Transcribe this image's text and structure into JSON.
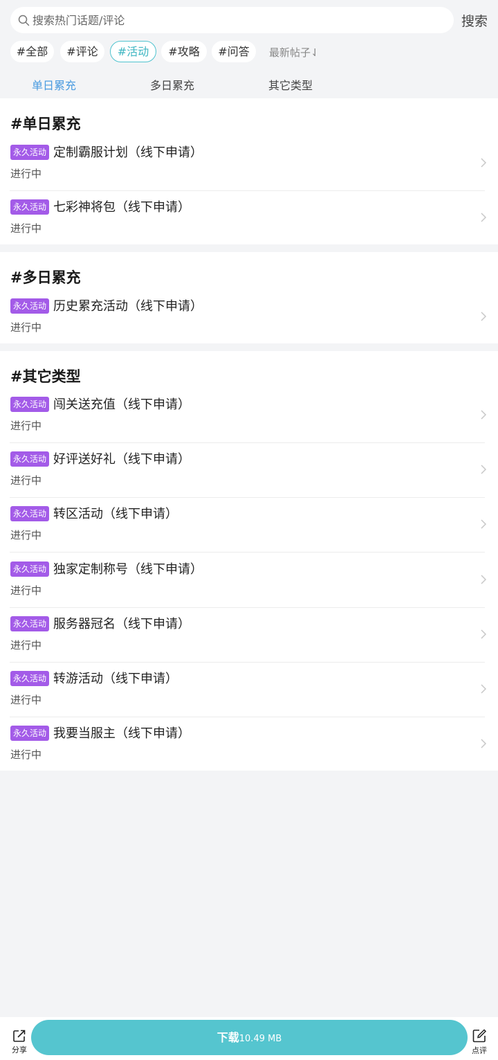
{
  "search": {
    "placeholder": "搜索热门话题/评论",
    "button": "搜索"
  },
  "chips": [
    {
      "label": "#全部"
    },
    {
      "label": "#评论"
    },
    {
      "label": "#活动"
    },
    {
      "label": "#攻略"
    },
    {
      "label": "#问答"
    }
  ],
  "sort_label": "最新帖子⇃",
  "tabs": [
    {
      "label": "单日累充"
    },
    {
      "label": "多日累充"
    },
    {
      "label": "其它类型"
    }
  ],
  "sections": [
    {
      "title": "#单日累充",
      "items": [
        {
          "badge": "永久活动",
          "title": "定制霸服计划（线下申请）",
          "status": "进行中"
        },
        {
          "badge": "永久活动",
          "title": "七彩神将包（线下申请）",
          "status": "进行中"
        }
      ]
    },
    {
      "title": "#多日累充",
      "items": [
        {
          "badge": "永久活动",
          "title": "历史累充活动（线下申请）",
          "status": "进行中"
        }
      ]
    },
    {
      "title": "#其它类型",
      "items": [
        {
          "badge": "永久活动",
          "title": "闯关送充值（线下申请）",
          "status": "进行中"
        },
        {
          "badge": "永久活动",
          "title": "好评送好礼（线下申请）",
          "status": "进行中"
        },
        {
          "badge": "永久活动",
          "title": "转区活动（线下申请）",
          "status": "进行中"
        },
        {
          "badge": "永久活动",
          "title": "独家定制称号（线下申请）",
          "status": "进行中"
        },
        {
          "badge": "永久活动",
          "title": "服务器冠名（线下申请）",
          "status": "进行中"
        },
        {
          "badge": "永久活动",
          "title": "转游活动（线下申请）",
          "status": "进行中"
        },
        {
          "badge": "永久活动",
          "title": "我要当服主（线下申请）",
          "status": "进行中"
        }
      ]
    }
  ],
  "bottom": {
    "share_label": "分享",
    "download_label": "下载",
    "download_size": "10.49 MB",
    "review_label": "点评"
  },
  "colors": {
    "accent": "#55c5cf",
    "badge": "#a35be8",
    "tab_active": "#4a9be0"
  }
}
